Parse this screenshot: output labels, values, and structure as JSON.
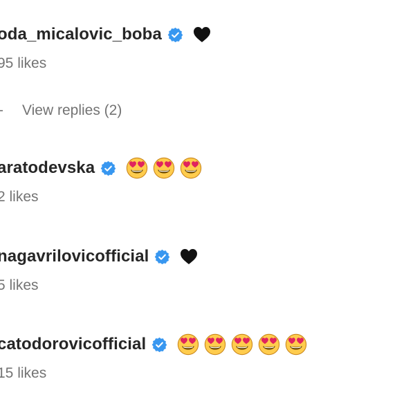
{
  "comments": [
    {
      "username": "oda_micalovic_boba",
      "verified": true,
      "content": [
        "black-heart"
      ],
      "likes": "95 likes"
    },
    {
      "username": "aratodevska",
      "verified": true,
      "content": [
        "heart-eyes-emoji",
        "heart-eyes-emoji",
        "heart-eyes-emoji"
      ],
      "likes": "2 likes"
    },
    {
      "username": "nagavrilovicofficial",
      "verified": true,
      "content": [
        "black-heart"
      ],
      "likes": "5 likes"
    },
    {
      "username": "catodorovicofficial",
      "verified": true,
      "content": [
        "heart-eyes-emoji",
        "heart-eyes-emoji",
        "heart-eyes-emoji",
        "heart-eyes-emoji",
        "heart-eyes-emoji"
      ],
      "likes": "15 likes"
    }
  ],
  "replies": {
    "label": "View replies (2)"
  },
  "colors": {
    "verified_badge": "#3897f0",
    "username": "#262626",
    "secondary_text": "#737373",
    "emoji_face": "#ffcc4d",
    "emoji_heart": "#e0245e"
  }
}
